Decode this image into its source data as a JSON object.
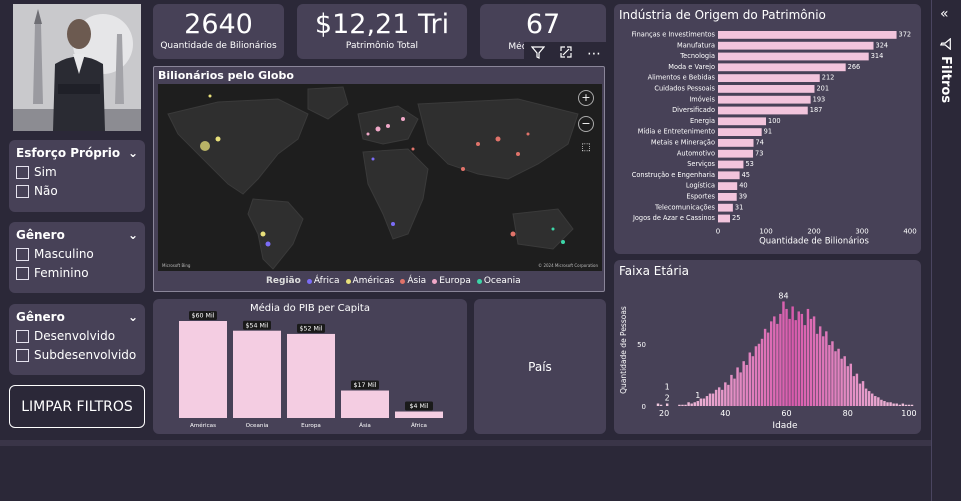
{
  "kpis": [
    {
      "value": "2640",
      "label": "Quantidade de Bilionários"
    },
    {
      "value": "$12,21 Tri",
      "label": "Patrimônio Total"
    },
    {
      "value": "67",
      "label": "Média de Idade"
    }
  ],
  "slicers": [
    {
      "title": "Esforço Próprio",
      "options": [
        "Sim",
        "Não"
      ]
    },
    {
      "title": "Gênero",
      "options": [
        "Masculino",
        "Feminino"
      ]
    },
    {
      "title": "Gênero",
      "options": [
        "Desenvolvido",
        "Subdesenvolvido"
      ]
    }
  ],
  "clear_button": "LIMPAR FILTROS",
  "map": {
    "title": "Bilionários pelo Globo",
    "legend_title": "Região",
    "legend": [
      {
        "name": "África",
        "color": "#7b6cf6"
      },
      {
        "name": "Américas",
        "color": "#e8e07a"
      },
      {
        "name": "Ásia",
        "color": "#e0736a"
      },
      {
        "name": "Europa",
        "color": "#f0a8c8"
      },
      {
        "name": "Oceania",
        "color": "#3cd6a8"
      }
    ],
    "attribution_left": "Microsoft Bing",
    "attribution_right": "© 2024 Microsoft Corporation"
  },
  "pais_label": "País",
  "right_pane_label": "Filtros",
  "charts": {
    "industry": {
      "title": "Indústria de Origem do Patrimônio",
      "xlabel": "Quantidade de Bilionários",
      "ticks": [
        "0",
        "100",
        "200",
        "300",
        "400"
      ]
    },
    "gdp": {
      "title": "Média do PIB per Capita"
    },
    "age": {
      "title": "Faixa Etária",
      "xlabel": "Idade",
      "ylabel": "Quantidade de Pessoas",
      "xticks": [
        "20",
        "40",
        "60",
        "80",
        "100"
      ],
      "yticks": [
        "0",
        "50"
      ]
    }
  },
  "chart_data": [
    {
      "type": "bar",
      "orientation": "horizontal",
      "title": "Indústria de Origem do Patrimônio",
      "xlabel": "Quantidade de Bilionários",
      "xlim": [
        0,
        400
      ],
      "categories": [
        "Finanças e Investimentos",
        "Manufatura",
        "Tecnologia",
        "Moda e Varejo",
        "Alimentos e Bebidas",
        "Cuidados Pessoais",
        "Imóveis",
        "Diversificado",
        "Energia",
        "Mídia e Entretenimento",
        "Metais e Mineração",
        "Automotivo",
        "Serviços",
        "Construção e Engenharia",
        "Logística",
        "Esportes",
        "Telecomunicações",
        "Jogos de Azar e Cassinos"
      ],
      "values": [
        372,
        324,
        314,
        266,
        212,
        201,
        193,
        187,
        100,
        91,
        74,
        73,
        53,
        45,
        40,
        39,
        31,
        25
      ]
    },
    {
      "type": "bar",
      "title": "Média do PIB per Capita",
      "categories": [
        "Américas",
        "Oceania",
        "Europa",
        "Ásia",
        "África"
      ],
      "values": [
        60,
        54,
        52,
        17,
        4
      ],
      "labels": [
        "$60 Mil",
        "$54 Mil",
        "$52 Mil",
        "$17 Mil",
        "$4 Mil"
      ],
      "ylim": [
        0,
        60
      ]
    },
    {
      "type": "bar",
      "title": "Faixa Etária",
      "xlabel": "Idade",
      "ylabel": "Quantidade de Pessoas",
      "xlim": [
        18,
        101
      ],
      "ylim": [
        0,
        90
      ],
      "x": [
        18,
        19,
        21,
        25,
        26,
        27,
        28,
        29,
        30,
        31,
        32,
        33,
        34,
        35,
        36,
        37,
        38,
        39,
        40,
        41,
        42,
        43,
        44,
        45,
        46,
        47,
        48,
        49,
        50,
        51,
        52,
        53,
        54,
        55,
        56,
        57,
        58,
        59,
        60,
        61,
        62,
        63,
        64,
        65,
        66,
        67,
        68,
        69,
        70,
        71,
        72,
        73,
        74,
        75,
        76,
        77,
        78,
        79,
        80,
        81,
        82,
        83,
        84,
        85,
        86,
        87,
        88,
        89,
        90,
        91,
        92,
        93,
        94,
        95,
        96,
        97,
        98,
        99,
        100,
        101
      ],
      "values": [
        2,
        1,
        2,
        1,
        1,
        1,
        3,
        2,
        3,
        4,
        6,
        6,
        8,
        10,
        10,
        13,
        15,
        13,
        19,
        17,
        25,
        22,
        31,
        27,
        36,
        33,
        43,
        40,
        48,
        50,
        54,
        62,
        59,
        68,
        72,
        66,
        74,
        84,
        78,
        70,
        80,
        69,
        76,
        74,
        65,
        78,
        70,
        72,
        58,
        64,
        56,
        60,
        49,
        52,
        44,
        46,
        38,
        40,
        32,
        34,
        24,
        26,
        18,
        20,
        14,
        12,
        10,
        8,
        7,
        5,
        4,
        3,
        3,
        2,
        2,
        1,
        2,
        1,
        1,
        1
      ],
      "annotations": [
        {
          "x": 59,
          "label": "84"
        },
        {
          "x": 21,
          "label": "2"
        },
        {
          "x": 21,
          "label": "1"
        },
        {
          "x": 31,
          "label": "1"
        }
      ]
    }
  ]
}
